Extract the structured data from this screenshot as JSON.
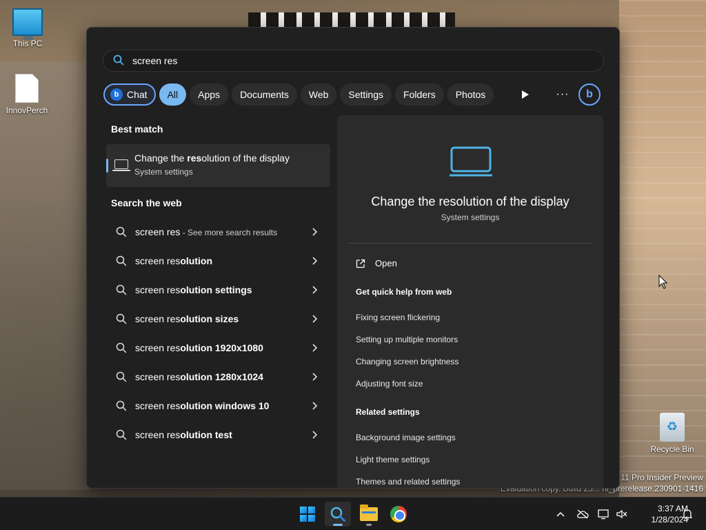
{
  "desktop": {
    "icons": [
      {
        "label": "This PC",
        "icon": "monitor-icon"
      },
      {
        "label": "InnovPerch",
        "icon": "file-icon"
      },
      {
        "label": "Recycle Bin",
        "icon": "recycle-bin-icon"
      }
    ],
    "watermark": {
      "line1": "11 Pro Insider Preview",
      "line2": "Evaluation copy. Build 23... ni_prerelease.230901-1416"
    }
  },
  "search": {
    "query": "screen res",
    "filters": [
      {
        "label": "Chat",
        "state": "chat"
      },
      {
        "label": "All",
        "state": "active"
      },
      {
        "label": "Apps",
        "state": ""
      },
      {
        "label": "Documents",
        "state": ""
      },
      {
        "label": "Web",
        "state": ""
      },
      {
        "label": "Settings",
        "state": ""
      },
      {
        "label": "Folders",
        "state": ""
      },
      {
        "label": "Photos",
        "state": ""
      }
    ],
    "more_label": "···",
    "best_match": {
      "heading": "Best match",
      "title_bold": "res",
      "title_pre": "Change the ",
      "title_post": "olution of the display",
      "subtitle": "System settings",
      "icon": "laptop-icon"
    },
    "web": {
      "heading": "Search the web",
      "items": [
        {
          "bold": "screen res",
          "rest": "",
          "more": " - See more search results"
        },
        {
          "bold": "screen res",
          "rest": "olution",
          "more": ""
        },
        {
          "bold": "screen res",
          "rest": "olution settings",
          "more": ""
        },
        {
          "bold": "screen res",
          "rest": "olution sizes",
          "more": ""
        },
        {
          "bold": "screen res",
          "rest": "olution 1920x1080",
          "more": ""
        },
        {
          "bold": "screen res",
          "rest": "olution 1280x1024",
          "more": ""
        },
        {
          "bold": "screen res",
          "rest": "olution windows 10",
          "more": ""
        },
        {
          "bold": "screen res",
          "rest": "olution test",
          "more": ""
        }
      ]
    },
    "detail": {
      "title": "Change the resolution of the display",
      "subtitle": "System settings",
      "open_label": "Open",
      "quick_help_heading": "Get quick help from web",
      "quick_help": [
        "Fixing screen flickering",
        "Setting up multiple monitors",
        "Changing screen brightness",
        "Adjusting font size"
      ],
      "related_heading": "Related settings",
      "related": [
        "Background image settings",
        "Light theme settings",
        "Themes and related settings"
      ]
    }
  },
  "taskbar": {
    "apps": [
      {
        "name": "start",
        "icon": "windows-logo-icon"
      },
      {
        "name": "search",
        "icon": "search-icon"
      },
      {
        "name": "file-explorer",
        "icon": "folder-icon"
      },
      {
        "name": "chrome",
        "icon": "chrome-icon"
      }
    ],
    "clock": {
      "time": "3:37 AM",
      "date": "1/28/2024"
    }
  },
  "colors": {
    "accent": "#78b9f0",
    "panel_bg": "#202020",
    "detail_bg": "#2b2b2b",
    "taskbar_bg": "#1c1c1c"
  }
}
